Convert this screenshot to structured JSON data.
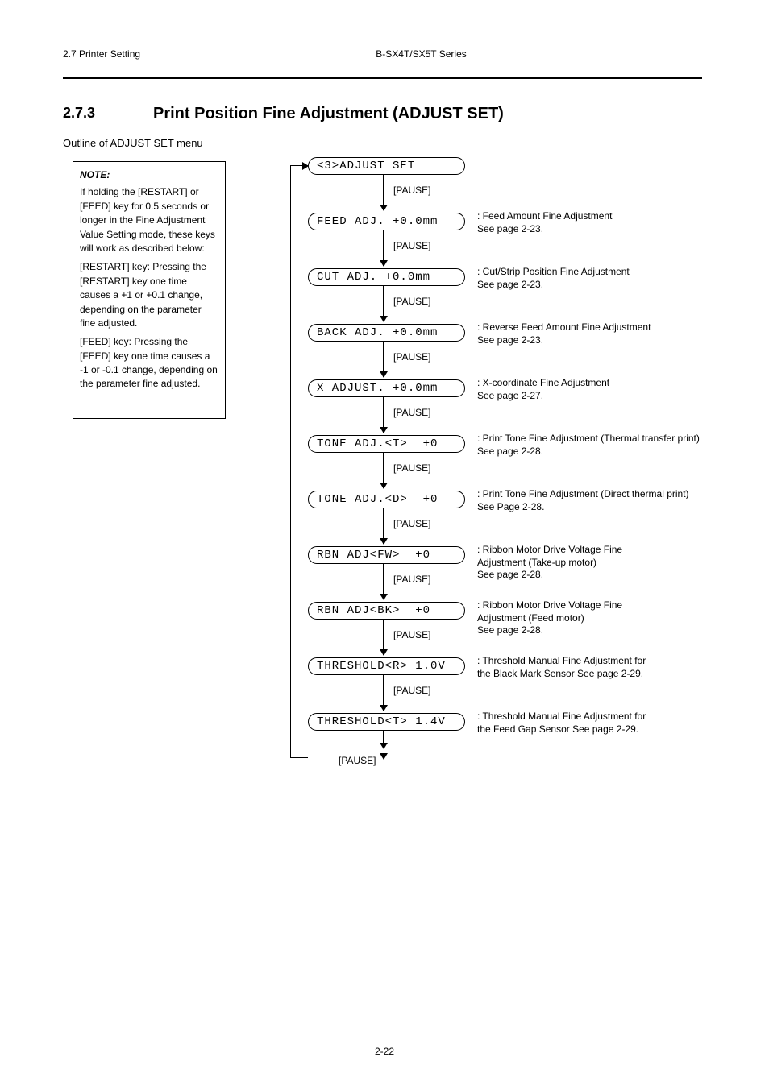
{
  "header": {
    "left": "2.7 Printer Setting",
    "center": "B-SX4T/SX5T Series",
    "right": ""
  },
  "section": {
    "no": "2.7.3",
    "title": "Print Position Fine Adjustment (ADJUST SET)"
  },
  "intro": "Outline of ADJUST SET menu",
  "note": {
    "title": "NOTE:",
    "p1": "If holding the [RESTART] or [FEED] key for 0.5 seconds or longer in the Fine Adjustment Value Setting mode, these keys will work as described below:",
    "p2_label": "[RESTART] key:",
    "p2_text": "Pressing the [RESTART] key one time causes a +1 or +0.1 change, depending on the parameter fine adjusted.",
    "p3_label": "[FEED] key:",
    "p3_text": "Pressing the [FEED] key one time causes a -1 or -0.1 change, depending on the parameter fine adjusted."
  },
  "steps": [
    {
      "lcd": "<3>ADJUST SET",
      "caption": "",
      "key": "[PAUSE]"
    },
    {
      "lcd": "FEED ADJ. +0.0mm",
      "caption": ": Feed Amount Fine Adjustment\n  See page 2-23.",
      "key": "[PAUSE]"
    },
    {
      "lcd": "CUT ADJ. +0.0mm",
      "caption": ": Cut/Strip Position Fine Adjustment\n  See page 2-23.",
      "key": "[PAUSE]"
    },
    {
      "lcd": "BACK ADJ. +0.0mm",
      "caption": ": Reverse Feed Amount Fine Adjustment\n  See page 2-23.",
      "key": "[PAUSE]"
    },
    {
      "lcd": "X ADJUST. +0.0mm",
      "caption": ": X-coordinate Fine Adjustment\n  See page 2-27.",
      "key": "[PAUSE]"
    },
    {
      "lcd": "TONE ADJ.<T>  +0",
      "caption": ": Print Tone Fine Adjustment (Thermal transfer print)\n  See page 2-28.",
      "key": "[PAUSE]"
    },
    {
      "lcd": "TONE ADJ.<D>  +0",
      "caption": ": Print Tone Fine Adjustment (Direct thermal print)\n  See Page 2-28.",
      "key": "[PAUSE]"
    },
    {
      "lcd": "RBN ADJ<FW>  +0",
      "caption": ": Ribbon Motor Drive Voltage Fine\n  Adjustment (Take-up motor)\n  See page 2-28.",
      "key": "[PAUSE]"
    },
    {
      "lcd": "RBN ADJ<BK>  +0",
      "caption": ": Ribbon Motor Drive Voltage Fine\n  Adjustment (Feed motor)\n  See page 2-28.",
      "key": "[PAUSE]"
    },
    {
      "lcd": "THRESHOLD<R> 1.0V",
      "caption": ": Threshold Manual Fine Adjustment for\n  the Black Mark Sensor See page 2-29.",
      "key": "[PAUSE]"
    },
    {
      "lcd": "THRESHOLD<T> 1.4V",
      "caption": ": Threshold Manual Fine Adjustment for\n  the Feed Gap Sensor  See page 2-29.",
      "key": "[PAUSE]"
    }
  ],
  "page_no": "2-22"
}
